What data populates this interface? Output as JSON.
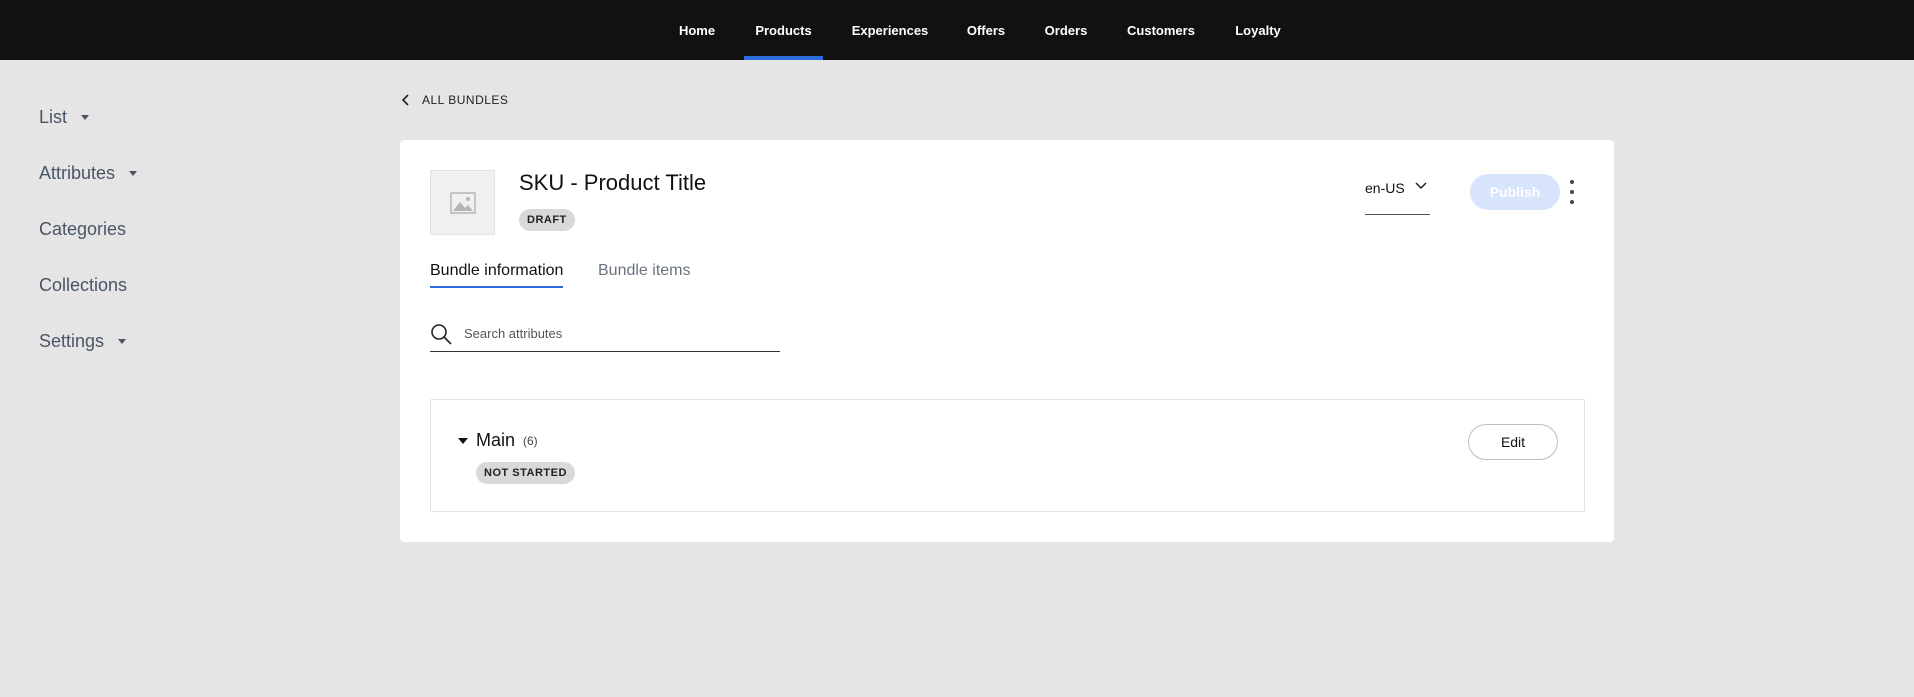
{
  "nav": {
    "items": [
      {
        "label": "Home",
        "active": false
      },
      {
        "label": "Products",
        "active": true
      },
      {
        "label": "Experiences",
        "active": false
      },
      {
        "label": "Offers",
        "active": false
      },
      {
        "label": "Orders",
        "active": false
      },
      {
        "label": "Customers",
        "active": false
      },
      {
        "label": "Loyalty",
        "active": false
      }
    ]
  },
  "sidebar": {
    "items": [
      {
        "label": "List",
        "has_caret": true
      },
      {
        "label": "Attributes",
        "has_caret": true
      },
      {
        "label": "Categories",
        "has_caret": false
      },
      {
        "label": "Collections",
        "has_caret": false
      },
      {
        "label": "Settings",
        "has_caret": true
      }
    ]
  },
  "breadcrumb": {
    "label": "ALL BUNDLES",
    "icon": "chevron-left-icon"
  },
  "product": {
    "title": "SKU - Product Title",
    "status": "DRAFT",
    "thumbnail_icon": "image-placeholder-icon"
  },
  "locale": {
    "value": "en-US"
  },
  "actions": {
    "publish_label": "Publish",
    "more_icon": "kebab-icon"
  },
  "tabs": [
    {
      "label": "Bundle information",
      "active": true
    },
    {
      "label": "Bundle items",
      "active": false
    }
  ],
  "search": {
    "placeholder": "Search attributes",
    "value": ""
  },
  "section": {
    "name": "Main",
    "count": "(6)",
    "status": "NOT STARTED",
    "edit_label": "Edit"
  },
  "colors": {
    "nav_bg": "#111111",
    "accent": "#2d6cdf",
    "page_bg": "#e5e5e5",
    "publish_disabled": "#d7e4fb"
  }
}
